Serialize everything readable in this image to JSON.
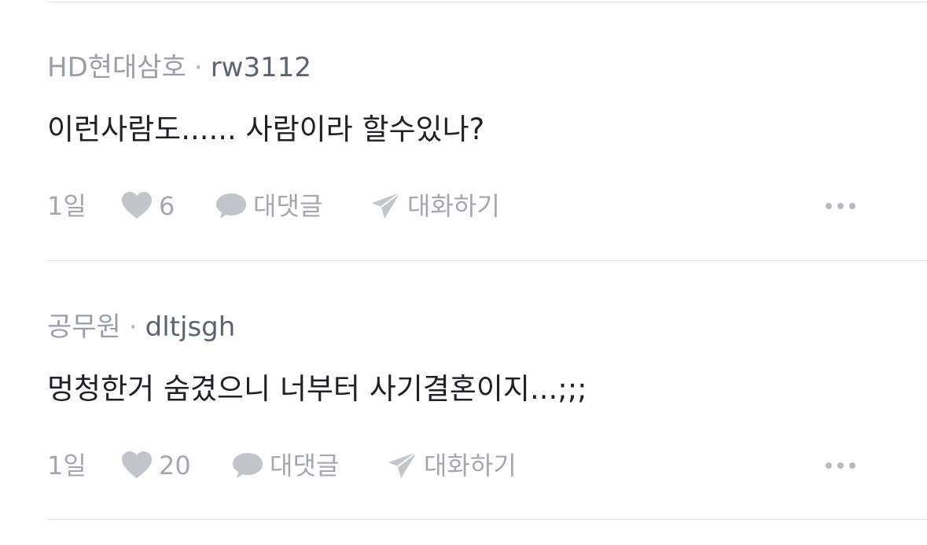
{
  "comments": [
    {
      "company": "HD현대삼호",
      "separator": "·",
      "username": "rw3112",
      "text": "이런사람도...... 사람이라 할수있나?",
      "time": "1일",
      "likes": "6",
      "reply_label": "대댓글",
      "chat_label": "대화하기",
      "icons": [
        "heart-icon",
        "speech-bubble-icon",
        "paper-plane-icon",
        "more-icon"
      ]
    },
    {
      "company": "공무원",
      "separator": "·",
      "username": "dltjsgh",
      "text": "멍청한거 숨겼으니 너부터 사기결혼이지...;;;",
      "time": "1일",
      "likes": "20",
      "reply_label": "대댓글",
      "chat_label": "대화하기",
      "icons": [
        "heart-icon",
        "speech-bubble-icon",
        "paper-plane-icon",
        "more-icon"
      ]
    }
  ]
}
